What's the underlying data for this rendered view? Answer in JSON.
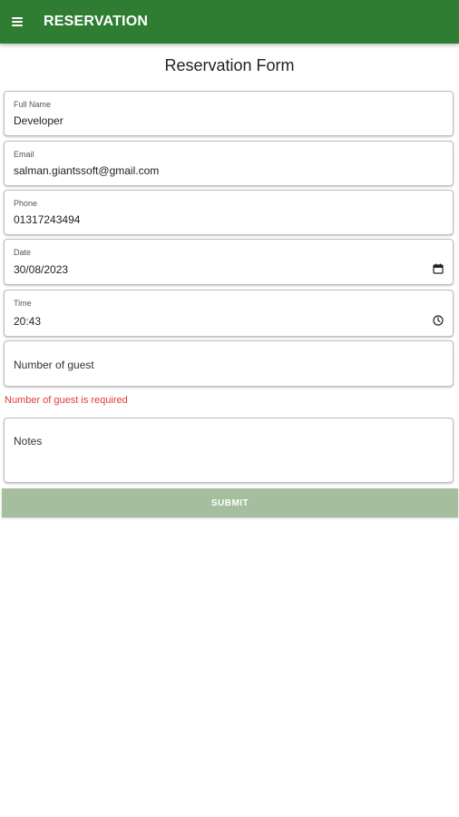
{
  "app_bar": {
    "title": "RESERVATION",
    "menu_icon": "hamburger-menu-icon",
    "color": "#2e7d32"
  },
  "form": {
    "title": "Reservation Form",
    "fields": {
      "full_name": {
        "label": "Full Name",
        "value": "Developer"
      },
      "email": {
        "label": "Email",
        "value": "salman.giantssoft@gmail.com"
      },
      "phone": {
        "label": "Phone",
        "value": "01317243494"
      },
      "date": {
        "label": "Date",
        "value": "30/08/2023",
        "icon": "calendar-icon"
      },
      "time": {
        "label": "Time",
        "value": "20:43",
        "icon": "clock-icon"
      },
      "guests": {
        "placeholder": "Number of guest",
        "error": "Number of guest is required"
      },
      "notes": {
        "placeholder": "Notes"
      }
    },
    "submit_label": "SUBMIT",
    "submit_color": "#a5bf9e",
    "error_color": "#e53935"
  }
}
